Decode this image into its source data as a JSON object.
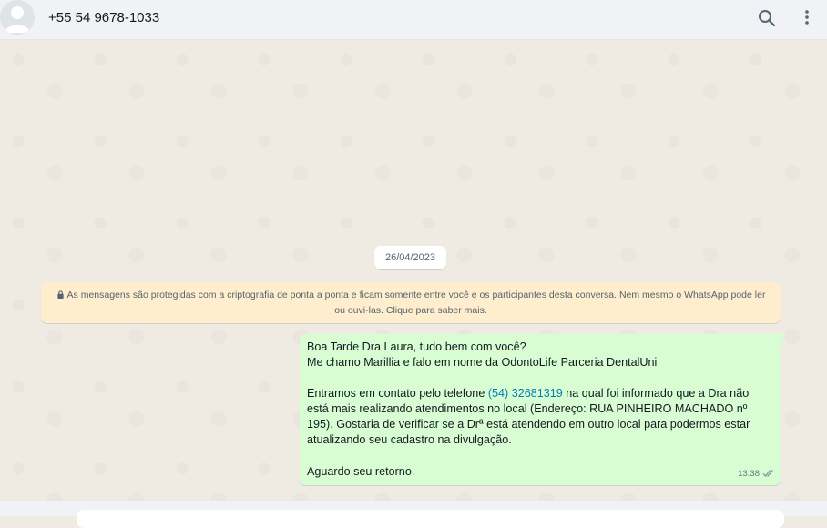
{
  "header": {
    "contact_name": "+55 54 9678-1033",
    "icons": [
      "avatar",
      "search-icon",
      "menu-icon"
    ]
  },
  "chat": {
    "date": "26/04/2023",
    "encryption_notice": "As mensagens são protegidas com a criptografia de ponta a ponta e ficam somente entre você e os participantes desta conversa. Nem mesmo o WhatsApp pode ler ou ouvi-las. Clique para saber mais.",
    "message": {
      "line1": "Boa Tarde Dra Laura, tudo bem com você?",
      "line2": "Me chamo Marillia e falo em nome da OdontoLife Parceria DentalUni",
      "para2_before": "Entramos em contato pelo telefone ",
      "phone": "(54) 32681319",
      "para2_after": " na qual foi informado que a Dra não está mais realizando atendimentos no local (Endereço: RUA PINHEIRO MACHADO nº 195). Gostaria de verificar se a Drª está atendendo em outro local para podermos estar atualizando seu cadastro na divulgação.",
      "closing": "Aguardo seu retorno.",
      "time": "13:38",
      "status": "delivered"
    }
  },
  "colors": {
    "outgoing_bubble": "#d9fdd3",
    "encryption_bg": "#ffeecd",
    "link": "#027eb5",
    "header_bg": "#f0f2f5",
    "chat_bg": "#efeae2"
  }
}
